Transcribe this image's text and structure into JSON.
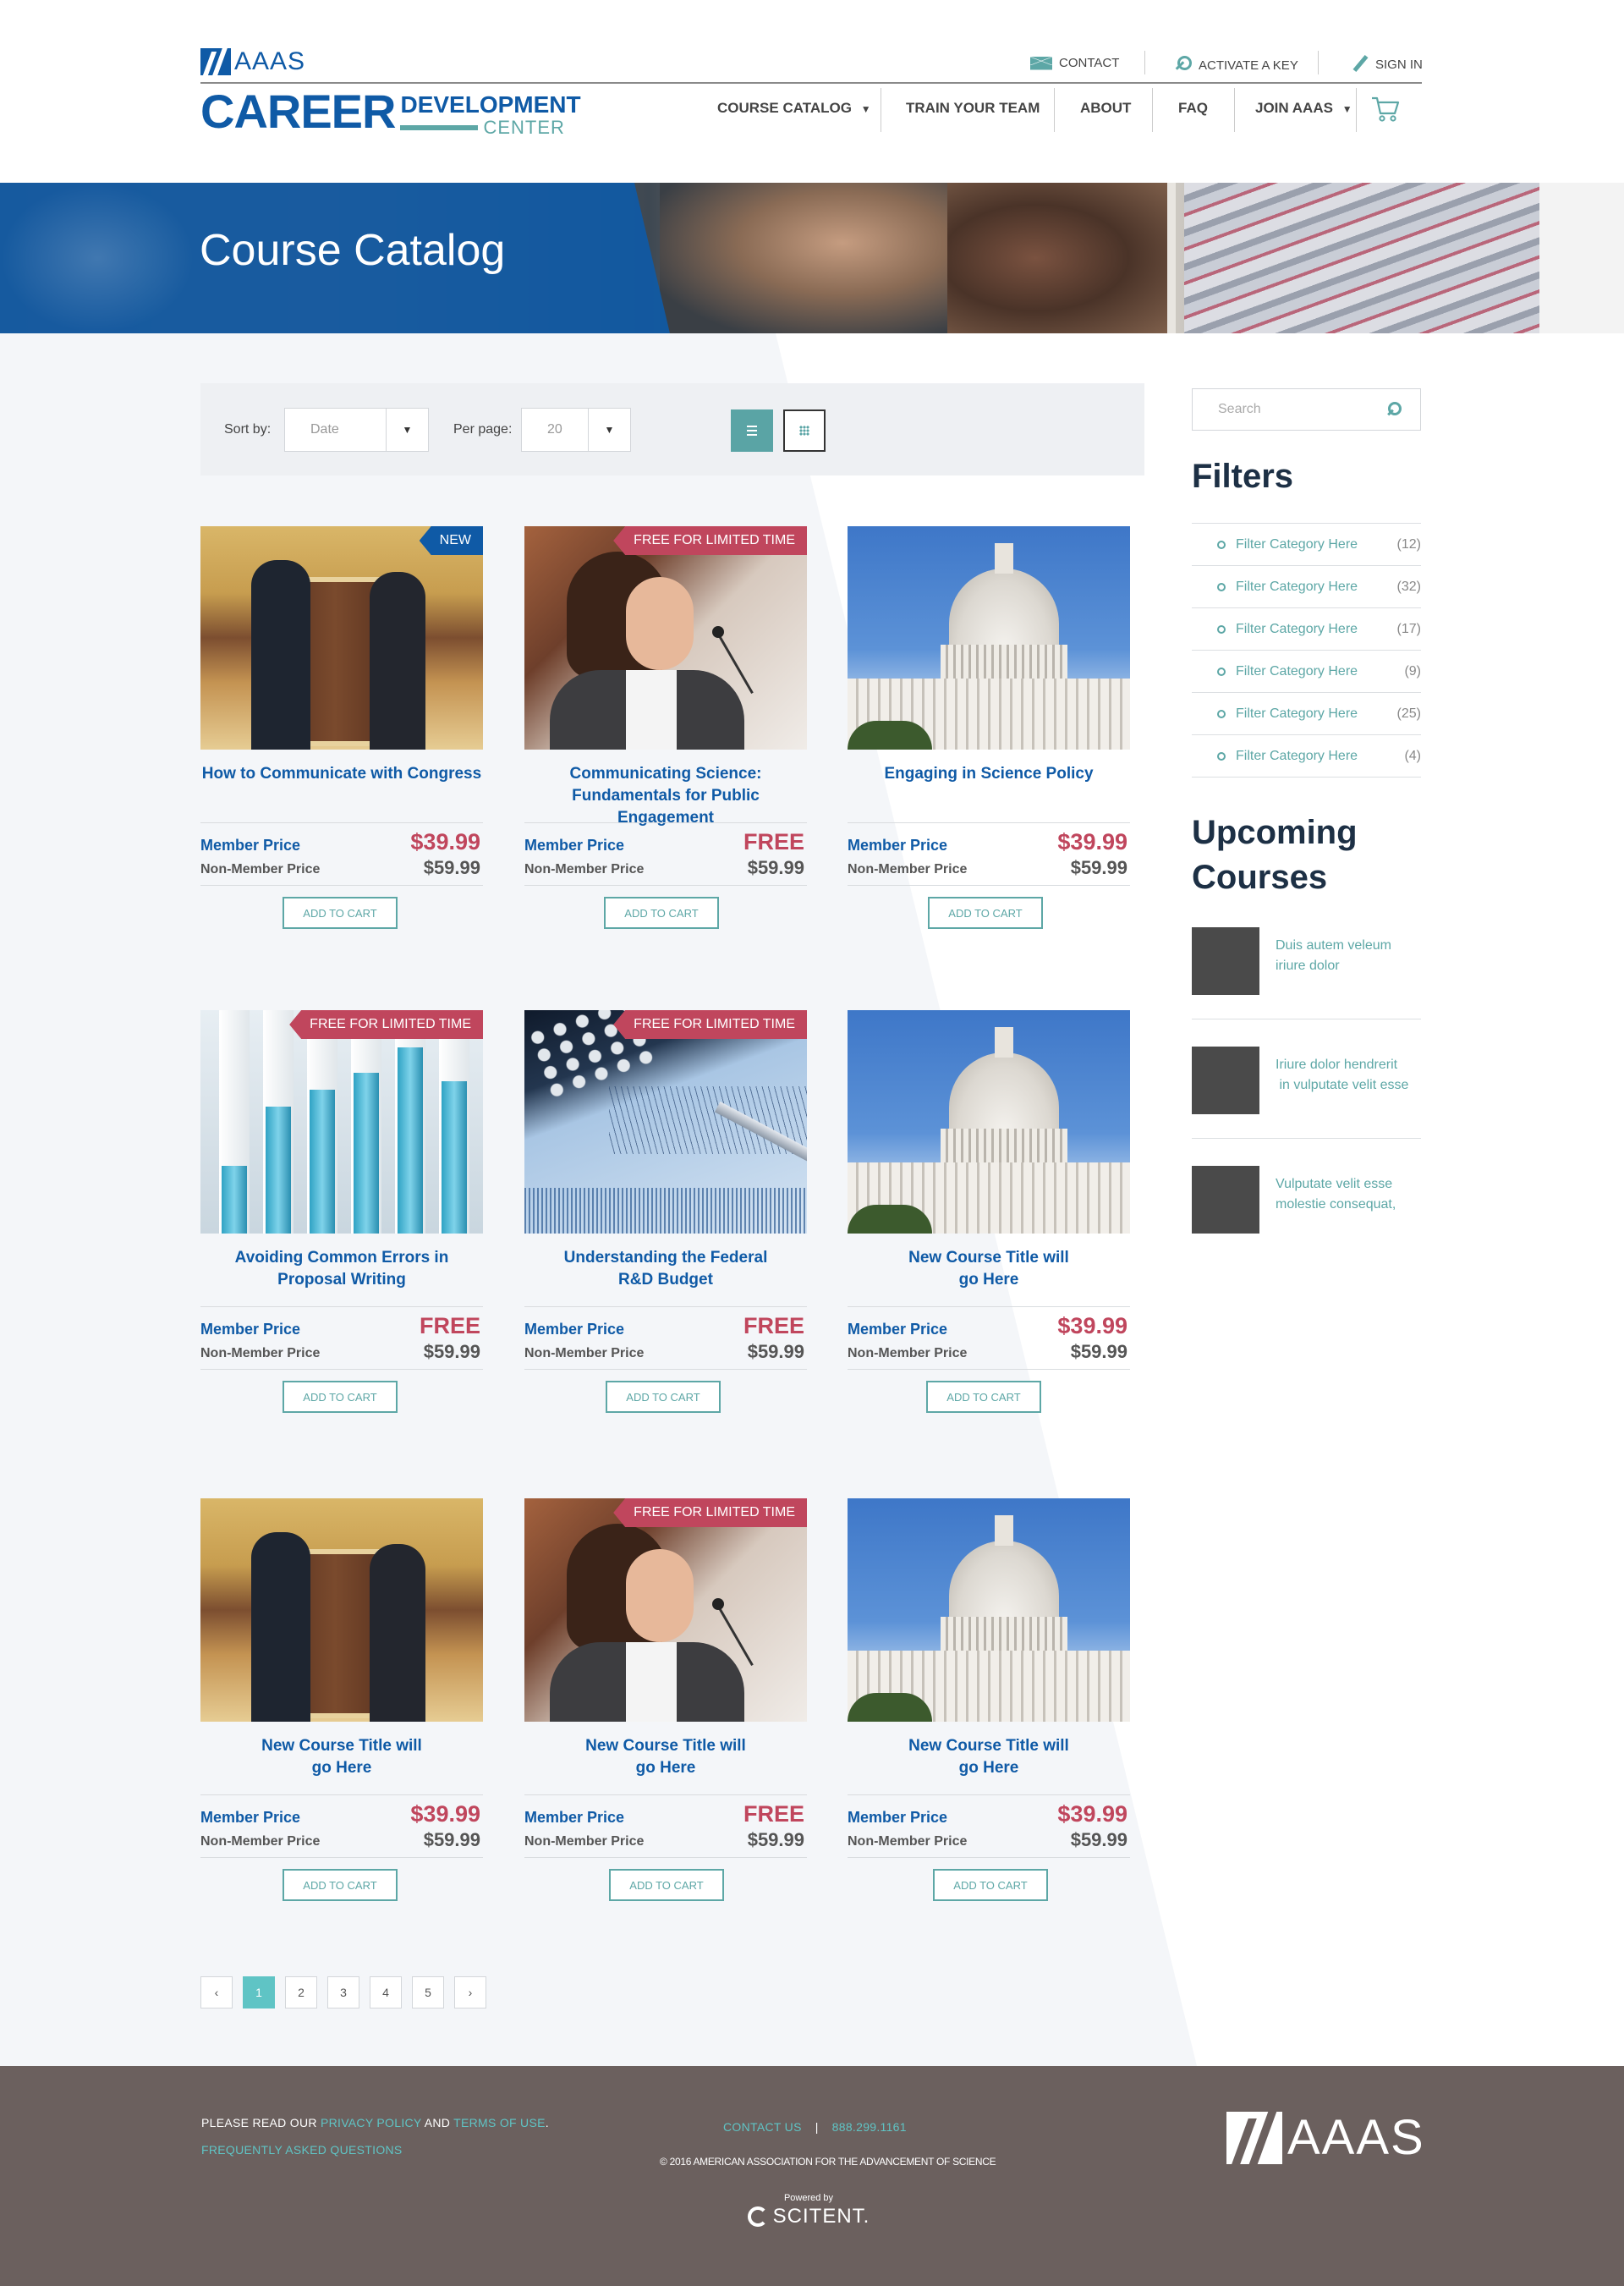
{
  "header": {
    "logo_text": "AAAS",
    "career": "CAREER",
    "development": "DEVELOPMENT",
    "center": "CENTER",
    "utility": [
      {
        "label": "CONTACT",
        "icon": "mail-icon"
      },
      {
        "label": "ACTIVATE A KEY",
        "icon": "key-icon"
      },
      {
        "label": "SIGN IN",
        "icon": "pen-icon"
      }
    ],
    "nav": [
      {
        "label": "COURSE CATALOG",
        "caret": "▼"
      },
      {
        "label": "TRAIN YOUR TEAM",
        "caret": ""
      },
      {
        "label": "ABOUT",
        "caret": ""
      },
      {
        "label": "FAQ",
        "caret": ""
      },
      {
        "label": "JOIN AAAS",
        "caret": "▼"
      }
    ],
    "cart_icon": "shopping-cart-icon"
  },
  "banner": {
    "title": "Course Catalog"
  },
  "toolbar": {
    "sort_label": "Sort by:",
    "sort_value": "Date",
    "per_page_label": "Per page:",
    "per_page_value": "20"
  },
  "labels": {
    "member": "Member Price",
    "non_member": "Non-Member Price",
    "add_to_cart": "ADD TO CART"
  },
  "products": [
    {
      "title": [
        "How to Communicate with Congress",
        ""
      ],
      "badge": "NEW",
      "image": "handshake",
      "member_price": "$39.99",
      "non_member_price": "$59.99"
    },
    {
      "title": [
        "Communicating Science:",
        "Fundamentals for Public Engagement"
      ],
      "badge": "FREE FOR LIMITED TIME",
      "image": "speaker",
      "member_price": "FREE",
      "non_member_price": "$59.99"
    },
    {
      "title": [
        "Engaging in Science Policy",
        ""
      ],
      "badge": "",
      "image": "capitol",
      "member_price": "$39.99",
      "non_member_price": "$59.99"
    },
    {
      "title": [
        "Avoiding Common Errors in",
        "Proposal Writing"
      ],
      "badge": "FREE FOR LIMITED TIME",
      "image": "bars",
      "member_price": "FREE",
      "non_member_price": "$59.99"
    },
    {
      "title": [
        "Understanding the Federal",
        "R&D Budget"
      ],
      "badge": "FREE FOR LIMITED TIME",
      "image": "finance",
      "member_price": "FREE",
      "non_member_price": "$59.99"
    },
    {
      "title": [
        "New Course Title will",
        "go Here"
      ],
      "badge": "",
      "image": "capitol",
      "member_price": "$39.99",
      "non_member_price": "$59.99"
    },
    {
      "title": [
        "New Course Title will",
        "go Here"
      ],
      "badge": "",
      "image": "handshake",
      "member_price": "$39.99",
      "non_member_price": "$59.99"
    },
    {
      "title": [
        "New Course Title will",
        "go Here"
      ],
      "badge": "FREE FOR LIMITED TIME",
      "image": "speaker",
      "member_price": "FREE",
      "non_member_price": "$59.99"
    },
    {
      "title": [
        "New Course Title will",
        "go Here"
      ],
      "badge": "",
      "image": "capitol",
      "member_price": "$39.99",
      "non_member_price": "$59.99"
    }
  ],
  "pagination": {
    "prev": "‹",
    "pages": [
      "1",
      "2",
      "3",
      "4",
      "5"
    ],
    "current": "1",
    "next": "›"
  },
  "sidebar": {
    "search_placeholder": "Search",
    "filters_title": "Filters",
    "filters": [
      {
        "label": "Filter Category Here",
        "count": "(12)"
      },
      {
        "label": "Filter Category Here",
        "count": "(32)"
      },
      {
        "label": "Filter Category Here",
        "count": "(17)"
      },
      {
        "label": "Filter Category Here",
        "count": "(9)"
      },
      {
        "label": "Filter Category Here",
        "count": "(25)"
      },
      {
        "label": "Filter Category Here",
        "count": "(4)"
      }
    ],
    "upcoming_title_1": "Upcoming",
    "upcoming_title_2": "Courses",
    "upcoming": [
      {
        "line1": "Duis autem veleum",
        "line2": "iriure dolor"
      },
      {
        "line1": "Iriure dolor hendrerit",
        "line2": " in vulputate velit esse"
      },
      {
        "line1": "Vulputate velit esse",
        "line2": "molestie consequat,"
      }
    ]
  },
  "footer": {
    "read_our": "PLEASE READ OUR ",
    "privacy": "PRIVACY POLICY",
    "and": " AND ",
    "terms": "TERMS OF USE",
    "period": ".",
    "faq": "FREQUENTLY ASKED QUESTIONS",
    "contact": "CONTACT US",
    "divider": "|",
    "phone": "888.299.1161",
    "copyright": "© 2016 AMERICAN ASSOCIATION FOR THE ADVANCEMENT OF SCIENCE",
    "powered_by": "Powered by",
    "scitent": "SCITENT.",
    "logo_text": "AAAS"
  },
  "colors": {
    "brand_blue": "#0f5aa6",
    "teal": "#5da7a6",
    "badge_red": "#c0465d",
    "footer_bg": "#6b605e"
  }
}
